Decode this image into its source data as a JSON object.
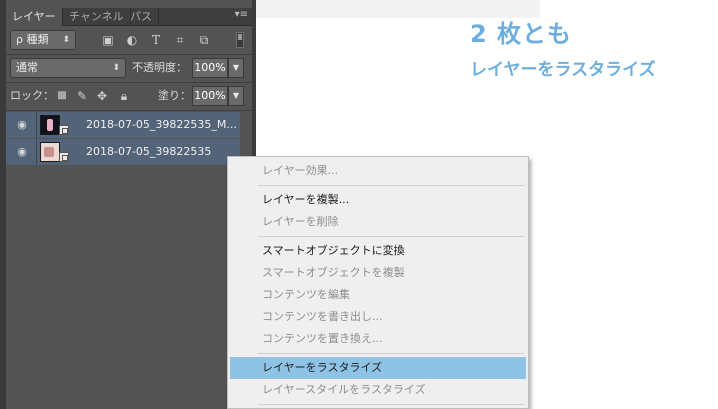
{
  "panel": {
    "tabs": [
      {
        "label": "レイヤー"
      },
      {
        "label": "チャンネル"
      },
      {
        "label": "パス"
      }
    ],
    "filter": {
      "label": "ρ 種類"
    },
    "blend_mode": "通常",
    "opacity": {
      "label": "不透明度：",
      "value": "100%"
    },
    "lock": {
      "label": "ロック："
    },
    "fill": {
      "label": "塗り：",
      "value": "100%"
    },
    "layers": [
      {
        "name": "2018-07-05_39822535_M...",
        "selected": true
      },
      {
        "name": "2018-07-05_39822535",
        "selected": true
      }
    ],
    "colors": {
      "background": "#535353",
      "selected_row": "#536479"
    }
  },
  "context_menu": {
    "items": [
      {
        "label": "レイヤー効果...",
        "enabled": false
      },
      {
        "label": "レイヤーを複製...",
        "enabled": true
      },
      {
        "label": "レイヤーを削除",
        "enabled": false
      },
      {
        "label": "スマートオブジェクトに変換",
        "enabled": true
      },
      {
        "label": "スマートオブジェクトを複製",
        "enabled": false
      },
      {
        "label": "コンテンツを編集",
        "enabled": false
      },
      {
        "label": "コンテンツを書き出し...",
        "enabled": false
      },
      {
        "label": "コンテンツを置き換え...",
        "enabled": false
      },
      {
        "label": "レイヤーをラスタライズ",
        "enabled": true,
        "highlighted": true
      },
      {
        "label": "レイヤースタイルをラスタライズ",
        "enabled": false
      }
    ],
    "colors": {
      "highlight": "#8fc3e6"
    }
  },
  "annotation": {
    "title": "2 枚とも",
    "subtitle": "レイヤーをラスタライズ",
    "color": "#6eaede"
  }
}
